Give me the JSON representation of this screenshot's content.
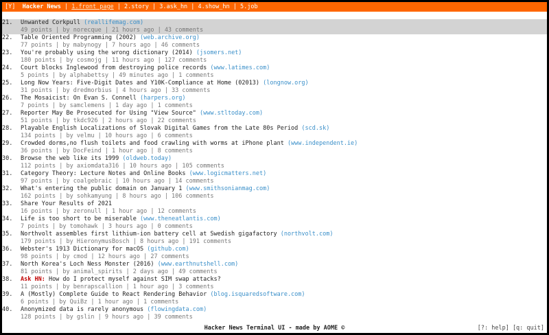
{
  "header": {
    "logo": "[Y]",
    "app_name": "Hacker News",
    "tabs": [
      "1.front_page",
      "2.story",
      "3.ask_hn",
      "4.show_hn",
      "5.job"
    ],
    "active_tab": 0
  },
  "stories": [
    {
      "num": "21.",
      "title": "Unwanted Corkpull",
      "domain": "(reallifemag.com)",
      "meta": "49 points | by norecque | 21 hours ago | 43 comments",
      "selected": true
    },
    {
      "num": "22.",
      "title": "Table Oriented Programming (2002)",
      "domain": "(web.archive.org)",
      "meta": "77 points | by mabynogy | 7 hours ago | 46 comments"
    },
    {
      "num": "23.",
      "title": "You're probably using the wrong dictionary (2014)",
      "domain": "(jsomers.net)",
      "meta": "180 points | by cosmojg | 11 hours ago | 127 comments"
    },
    {
      "num": "24.",
      "title": "Court blocks Inglewood from destroying police records",
      "domain": "(www.latimes.com)",
      "meta": "5 points | by alphabettsy | 49 minutes ago | 1 comments"
    },
    {
      "num": "25.",
      "title": "Long Now Years: Five-Digit Dates and Y10K-Compliance at Home (02013)",
      "domain": "(longnow.org)",
      "meta": "31 points | by dredmorbius | 4 hours ago | 33 comments"
    },
    {
      "num": "26.",
      "title": "The Mosaicist: On Evan S. Connell",
      "domain": "(harpers.org)",
      "meta": "7 points | by samclemens | 1 day ago | 1 comments"
    },
    {
      "num": "27.",
      "title": "Reporter May Be Prosecuted for Using \"View Source\"",
      "domain": "(www.stltoday.com)",
      "meta": "51 points | by tkdc926 | 2 hours ago | 22 comments"
    },
    {
      "num": "28.",
      "title": "Playable English Localizations of Slovak Digital Games from the Late 80s Period",
      "domain": "(scd.sk)",
      "meta": "134 points | by velmu | 10 hours ago | 6 comments"
    },
    {
      "num": "29.",
      "title": "Crowded dorms,no flush toilets and food crawling with worms at iPhone plant",
      "domain": "(www.independent.ie)",
      "meta": "36 points | by DocFeind | 1 hour ago | 8 comments"
    },
    {
      "num": "30.",
      "title": "Browse the web like its 1999",
      "domain": "(oldweb.today)",
      "meta": "112 points | by axiomdata316 | 10 hours ago | 105 comments"
    },
    {
      "num": "31.",
      "title": "Category Theory: Lecture Notes and Online Books",
      "domain": "(www.logicmatters.net)",
      "meta": "97 points | by coalgebraic | 10 hours ago | 14 comments"
    },
    {
      "num": "32.",
      "title": "What's entering the public domain on January 1",
      "domain": "(www.smithsonianmag.com)",
      "meta": "162 points | by sohkamyung | 8 hours ago | 106 comments"
    },
    {
      "num": "33.",
      "title": "Share Your Results of 2021",
      "domain": "",
      "meta": "16 points | by zeronull | 1 hour ago | 12 comments"
    },
    {
      "num": "34.",
      "title": "Life is too short to be miserable",
      "domain": "(www.theneatlantis.com)",
      "meta": "7 points | by tomohawk | 3 hours ago | 0 comments"
    },
    {
      "num": "35.",
      "title": "Northvolt assembles first lithium-ion battery cell at Swedish gigafactory",
      "domain": "(northvolt.com)",
      "meta": "179 points | by HieronymusBosch | 8 hours ago | 191 comments"
    },
    {
      "num": "36.",
      "title": "Webster's 1913 Dictionary for macOS",
      "domain": "(github.com)",
      "meta": "98 points | by cmod | 12 hours ago | 27 comments"
    },
    {
      "num": "37.",
      "title": "North Korea's Loch Ness Monster (2016)",
      "domain": "(www.earthnutshell.com)",
      "meta": "81 points | by animal_spirits | 2 days ago | 49 comments"
    },
    {
      "num": "38.",
      "prefix": "Ask HN:",
      "title": " How do I protect myself against SIM swap attacks?",
      "domain": "",
      "meta": "11 points | by benrapscallion | 1 hour ago | 3 comments"
    },
    {
      "num": "39.",
      "title": "A (Mostly) Complete Guide to React Rendering Behavior",
      "domain": "(blog.isquaredsoftware.com)",
      "meta": "6 points | by QuiBz | 1 hour ago | 1 comments"
    },
    {
      "num": "40.",
      "title": "Anonymized data is rarely anonymous",
      "domain": "(flowingdata.com)",
      "meta": "128 points | by gslin | 9 hours ago | 39 comments"
    }
  ],
  "footer": {
    "title": "Hacker News Terminal UI - made by AOME ©",
    "help_key": "[?: help]",
    "quit_key": "[q: quit]"
  },
  "colors": {
    "accent": "#ff6600",
    "domain": "#3a8fc9",
    "ask_prefix": "#c00000",
    "selected_row": "#d3d3d3"
  }
}
